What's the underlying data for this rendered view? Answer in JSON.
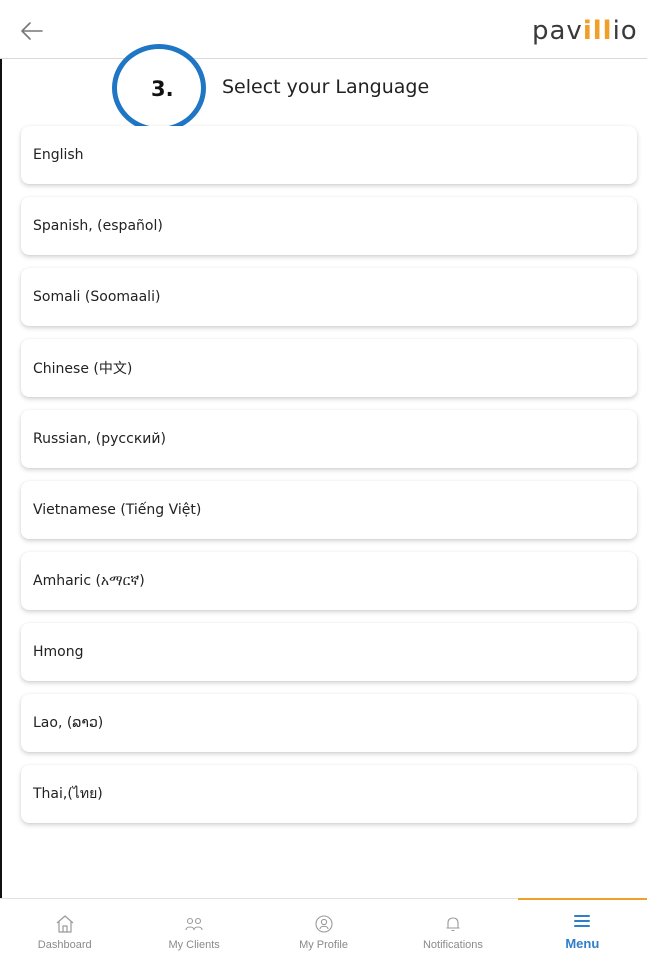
{
  "header": {
    "logo_text_start": "pav",
    "logo_text_accent": "ill",
    "logo_text_end": "io"
  },
  "page": {
    "title": "Select your Language",
    "step_marker": "3."
  },
  "languages": [
    "English",
    "Spanish, (español)",
    "Somali (Soomaali)",
    "Chinese (中文)",
    "Russian, (русский)",
    "Vietnamese (Tiếng Việt)",
    "Amharic (አማርኛ)",
    "Hmong",
    "Lao, (ລາວ)",
    "Thai,(ไทย)"
  ],
  "bottom_nav": [
    {
      "label": "Dashboard",
      "icon": "home-icon"
    },
    {
      "label": "My Clients",
      "icon": "clients-icon"
    },
    {
      "label": "My Profile",
      "icon": "profile-icon"
    },
    {
      "label": "Notifications",
      "icon": "bell-icon"
    },
    {
      "label": "Menu",
      "icon": "menu-icon"
    }
  ],
  "colors": {
    "accent_orange": "#f0a028",
    "active_blue": "#2f7ec9",
    "step_circle_blue": "#1f76c4"
  }
}
